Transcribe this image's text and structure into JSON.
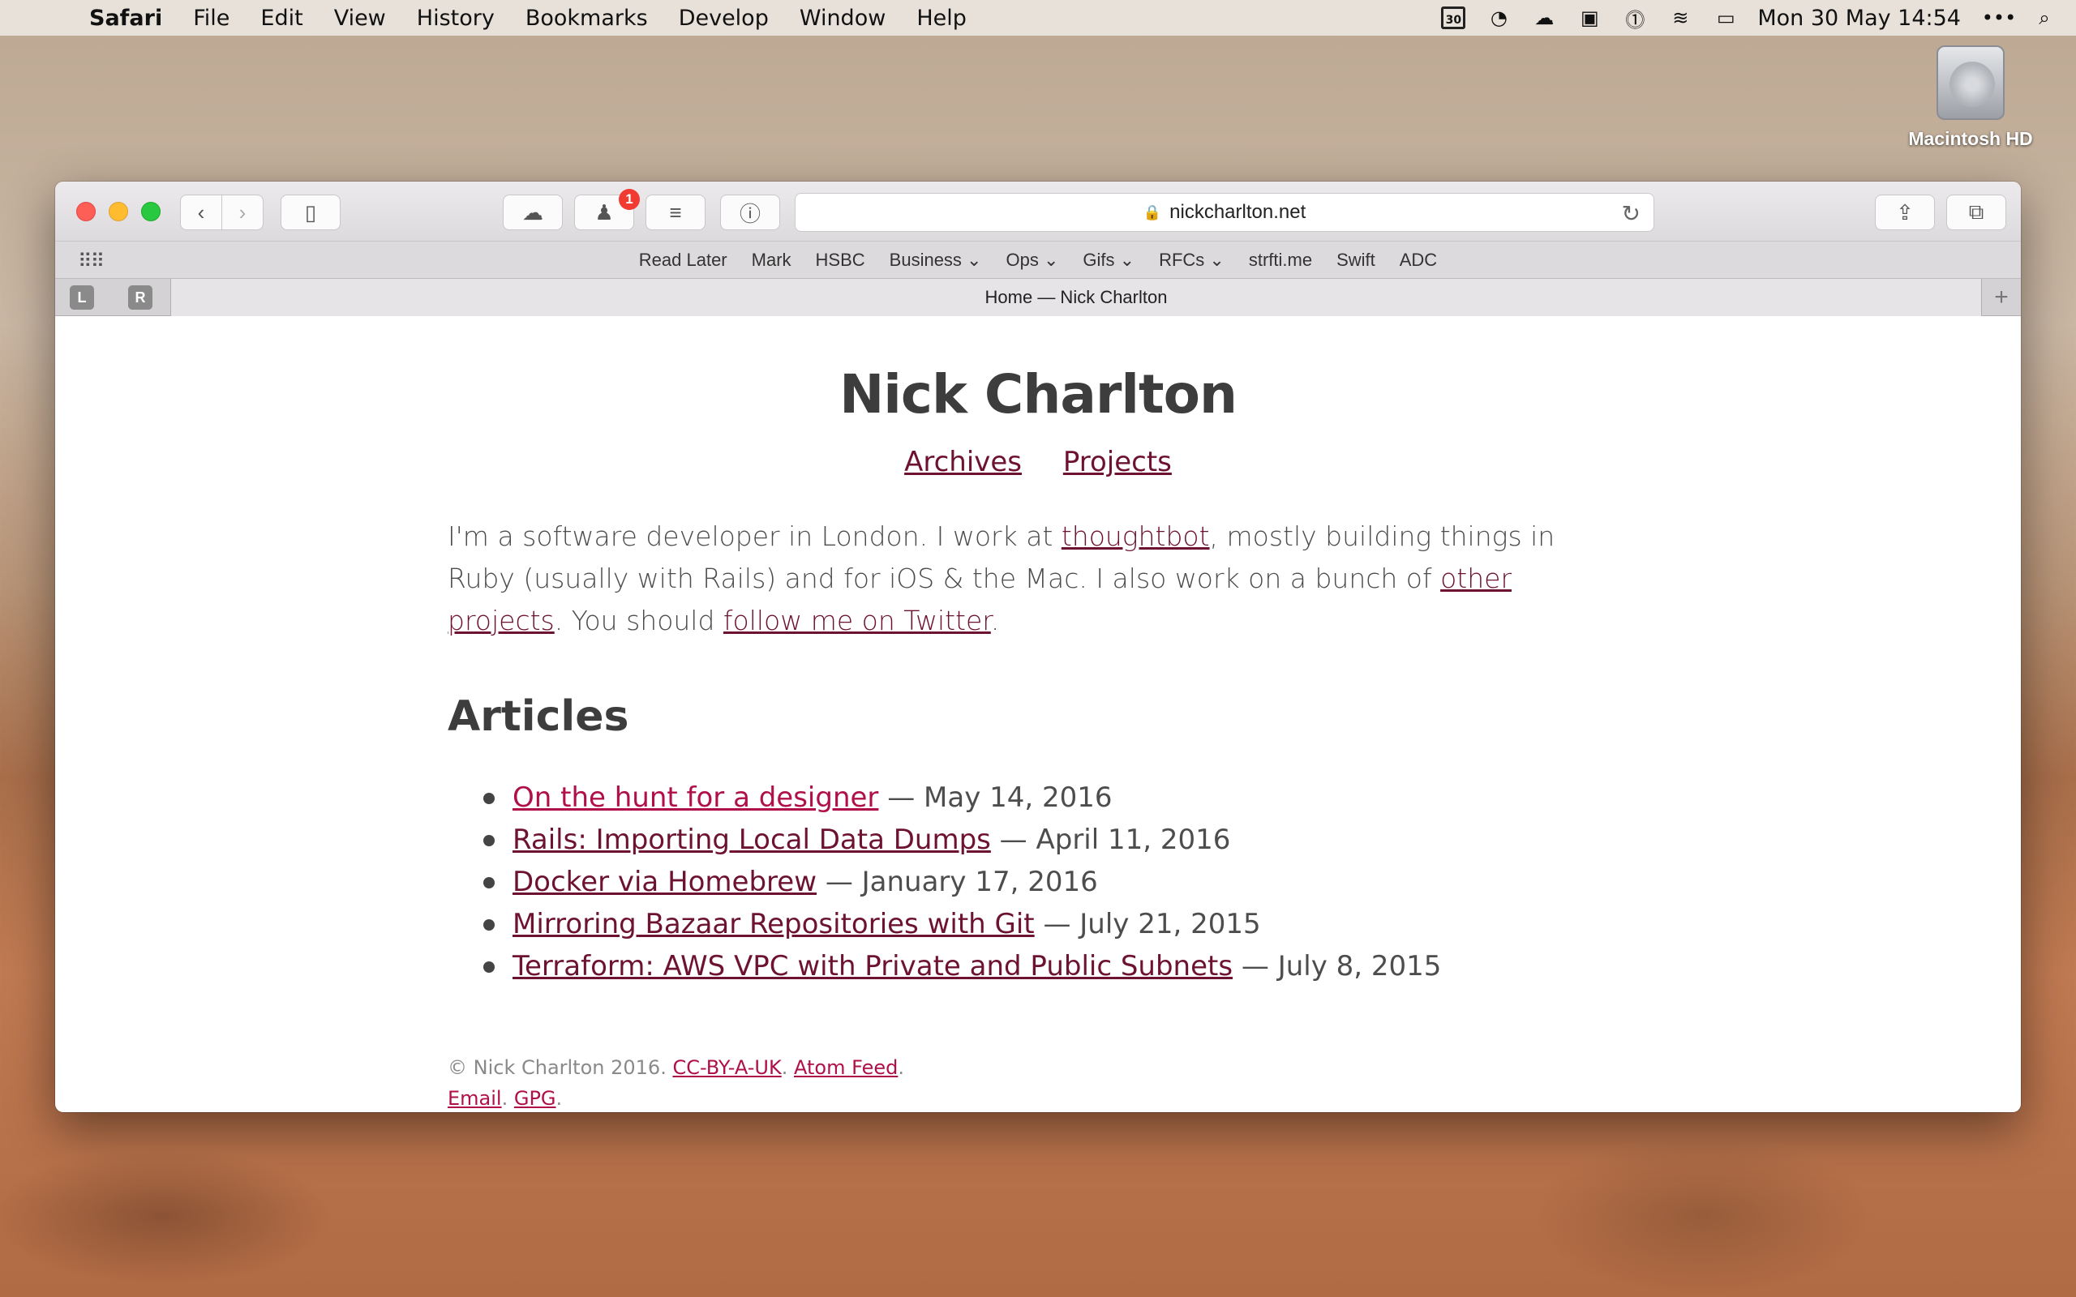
{
  "menubar": {
    "app": "Safari",
    "items": [
      "File",
      "Edit",
      "View",
      "History",
      "Bookmarks",
      "Develop",
      "Window",
      "Help"
    ],
    "calendar_day": "30",
    "clock": "Mon 30 May  14:54",
    "more": "•••"
  },
  "desktop": {
    "disk_label": "Macintosh HD"
  },
  "browser": {
    "url": "nickcharlton.net",
    "badge_count": "1",
    "favorites": [
      "Read Later",
      "Mark",
      "HSBC",
      "Business ⌄",
      "Ops ⌄",
      "Gifs ⌄",
      "RFCs ⌄",
      "strfti.me",
      "Swift",
      "ADC"
    ],
    "pinned_tabs": [
      "L",
      "R"
    ],
    "tab_title": "Home — Nick Charlton"
  },
  "page": {
    "title": "Nick Charlton",
    "nav": [
      "Archives",
      "Projects"
    ],
    "intro": {
      "p1": "I'm a software developer in London. I work at ",
      "link1": "thoughtbot",
      "p2": ", mostly building things in Ruby (usually with Rails) and for iOS & the Mac. I also work on a bunch of ",
      "link2": "other projects",
      "p3": ". You should ",
      "link3": "follow me on Twitter",
      "p4": "."
    },
    "articles_heading": "Articles",
    "articles": [
      {
        "title": "On the hunt for a designer",
        "date": " — May 14, 2016"
      },
      {
        "title": "Rails: Importing Local Data Dumps",
        "date": " — April 11, 2016"
      },
      {
        "title": "Docker via Homebrew",
        "date": " — January 17, 2016"
      },
      {
        "title": "Mirroring Bazaar Repositories with Git",
        "date": " — July 21, 2015"
      },
      {
        "title": "Terraform: AWS VPC with Private and Public Subnets",
        "date": " — July 8, 2015"
      }
    ],
    "footer": {
      "copyright": "© Nick Charlton 2016. ",
      "license": "CC-BY-A-UK",
      "sep1": ". ",
      "feed": "Atom Feed",
      "sep2": ".",
      "email": "Email",
      "sep3": ". ",
      "gpg": "GPG",
      "sep4": "."
    }
  },
  "colors": {
    "link": "#6d1231",
    "link_hover": "#b0104a",
    "heading": "#3d3d3d"
  }
}
